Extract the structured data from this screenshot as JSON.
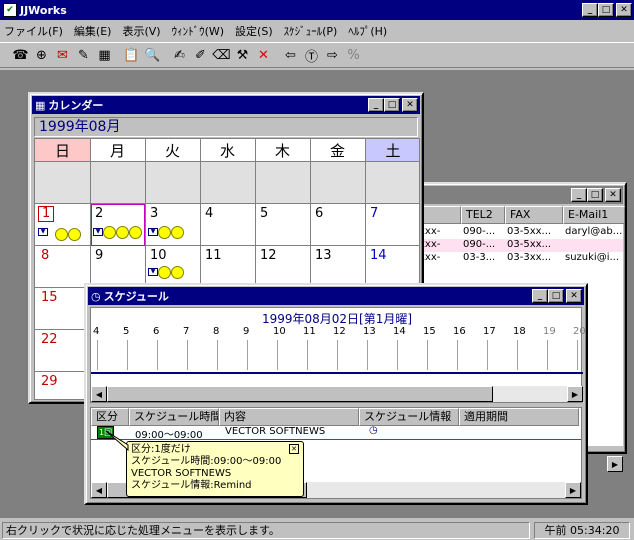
{
  "app": {
    "title": "JJWorks"
  },
  "menu": [
    "ファイル(F)",
    "編集(E)",
    "表示(V)",
    "ｳｨﾝﾄﾞｳ(W)",
    "設定(S)",
    "ｽｹｼﾞｭｰﾙ(P)",
    "ﾍﾙﾌﾟ(H)"
  ],
  "calendar": {
    "title": "カレンダー",
    "month": "1999年08月",
    "weekdays": [
      "日",
      "月",
      "火",
      "水",
      "木",
      "金",
      "土"
    ],
    "rows": [
      [
        "1",
        "2",
        "3",
        "4",
        "5",
        "6",
        "7"
      ],
      [
        "8",
        "9",
        "10",
        "11",
        "12",
        "13",
        "14"
      ],
      [
        "15",
        "",
        "",
        "",
        "",
        "",
        ""
      ],
      [
        "22",
        "",
        "",
        "",
        "",
        "",
        ""
      ],
      [
        "29",
        "",
        "",
        "",
        "",
        "",
        ""
      ]
    ]
  },
  "address": {
    "headers": [
      "TEL2",
      "FAX",
      "E-Mail1"
    ],
    "rows": [
      [
        "xxx-",
        "090-...",
        "03-5xx...",
        "daryl@ab..."
      ],
      [
        "xxx-",
        "090-...",
        "03-5xx...",
        ""
      ],
      [
        "xxx-",
        "03-3...",
        "03-3xx...",
        "suzuki@i..."
      ]
    ]
  },
  "schedule": {
    "title": "スケジュール",
    "date_heading": "1999年08月02日[第1月曜]",
    "hours": [
      "4",
      "5",
      "6",
      "7",
      "8",
      "9",
      "10",
      "11",
      "12",
      "13",
      "14",
      "15",
      "16",
      "17",
      "18",
      "19",
      "20"
    ],
    "columns": [
      "区分",
      "スケジュール時間",
      "内容",
      "スケジュール情報",
      "適用期間"
    ],
    "row": {
      "kubun": "1回",
      "time": "09:00～09:00",
      "content": "VECTOR SOFTNEWS"
    },
    "tooltip": [
      "区分:1度だけ",
      "スケジュール時間:09:00～09:00",
      "VECTOR SOFTNEWS",
      "スケジュール情報:Remind"
    ]
  },
  "status": {
    "message": "右クリックで状況に応じた処理メニューを表示します。",
    "clock": "午前 05:34:20"
  },
  "colors": {
    "titlebar": "#000080",
    "desktop": "#808080",
    "sunday": "#c00000",
    "saturday": "#0000c0",
    "tooltip": "#ffffc0"
  }
}
